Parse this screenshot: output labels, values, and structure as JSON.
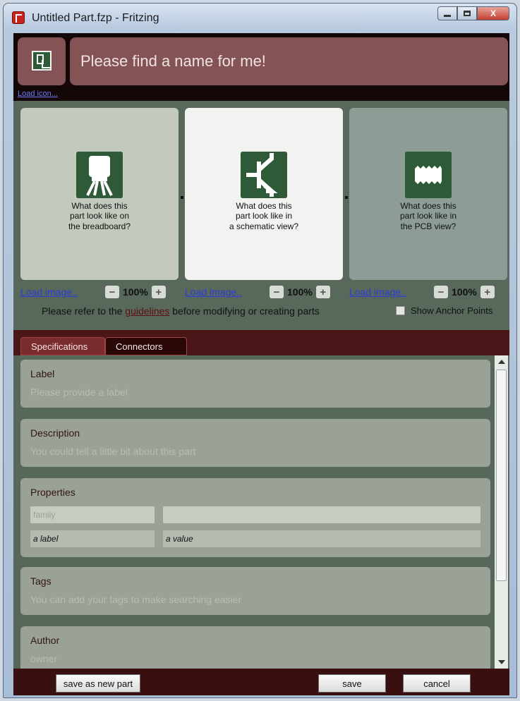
{
  "window": {
    "title": "Untitled Part.fzp - Fritzing",
    "controls": {
      "minimize": "minimize-icon",
      "maximize": "maximize-icon",
      "close": "close-icon"
    },
    "close_glyph": "X"
  },
  "header": {
    "name_placeholder": "Please find a name for me!",
    "load_icon_label": "Load icon..."
  },
  "views": [
    {
      "lines": [
        "What does this",
        "part look like on",
        "the breadboard?"
      ],
      "load_label": "Load image..",
      "zoom": "100%",
      "icon": "breadboard-icon"
    },
    {
      "lines": [
        "What does this",
        "part look like in",
        "a schematic view?"
      ],
      "load_label": "Load image..",
      "zoom": "100%",
      "icon": "schematic-icon"
    },
    {
      "lines": [
        "What does this",
        "part look like in",
        "the PCB view?"
      ],
      "load_label": "Load image..",
      "zoom": "100%",
      "icon": "pcb-icon"
    }
  ],
  "zoom_minus": "−",
  "zoom_plus": "+",
  "guidelines": {
    "before": "Please refer to the ",
    "link": "guidelines",
    "after": " before modifying or creating parts"
  },
  "show_anchor_points_label": "Show Anchor Points",
  "tabs": [
    "Specifications",
    "Connectors"
  ],
  "sections": {
    "label": {
      "title": "Label",
      "hint": "Please provide a label"
    },
    "description": {
      "title": "Description",
      "hint": "You could tell a little bit about this part"
    },
    "properties": {
      "title": "Properties",
      "rows": [
        {
          "key": "family",
          "value": ""
        },
        {
          "key": "a label",
          "value": "a value"
        }
      ]
    },
    "tags": {
      "title": "Tags",
      "hint": "You can add your tags to make searching easier"
    },
    "author": {
      "title": "Author",
      "hint": "owner"
    }
  },
  "footer": {
    "save_as_new": "save as new part",
    "save": "save",
    "cancel": "cancel"
  },
  "colors": {
    "header_tile": "#835355",
    "view_background": "#58685b",
    "section_background": "#9aa196",
    "footer_background": "#3a0f10"
  }
}
